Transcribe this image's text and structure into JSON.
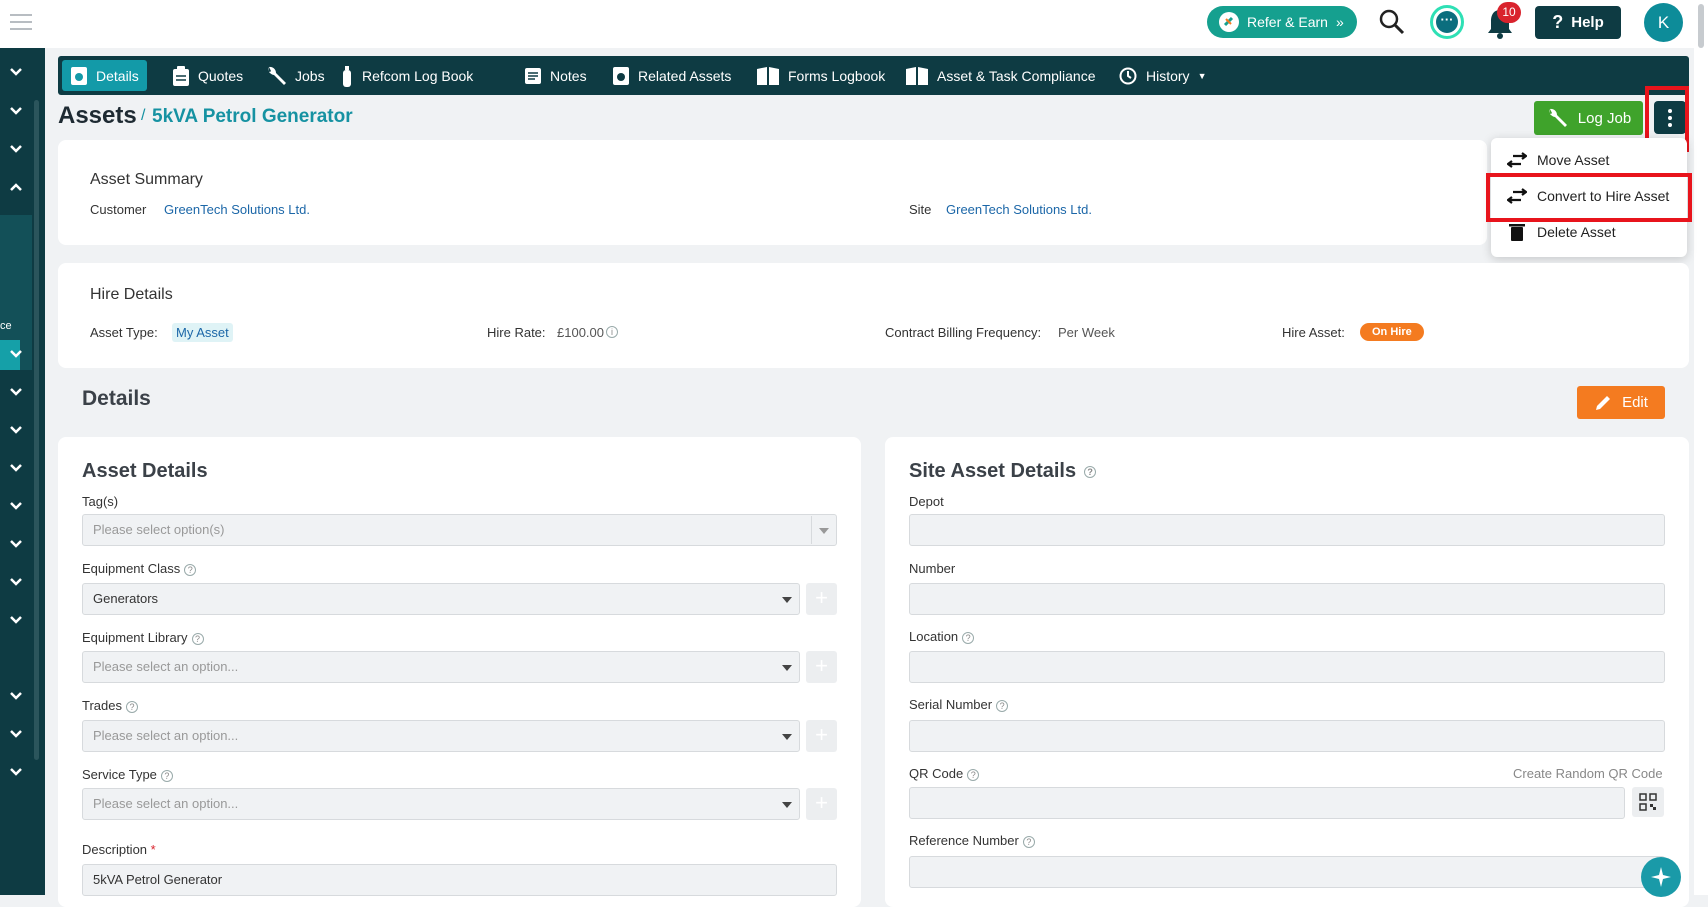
{
  "topbar": {
    "refer_label": "Refer & Earn",
    "notifications_count": "10",
    "help_label": "Help",
    "avatar_initial": "K"
  },
  "sidebar": {
    "partial_label": "ce"
  },
  "nav": {
    "tabs": [
      {
        "label": "Details",
        "icon": "asset-icon"
      },
      {
        "label": "Quotes",
        "icon": "clipboard-icon"
      },
      {
        "label": "Jobs",
        "icon": "wrench-icon"
      },
      {
        "label": "Refcom Log Book",
        "icon": "gas-bottle-icon"
      },
      {
        "label": "Notes",
        "icon": "note-icon"
      },
      {
        "label": "Related Assets",
        "icon": "asset-icon"
      },
      {
        "label": "Forms Logbook",
        "icon": "book-icon"
      },
      {
        "label": "Asset & Task Compliance",
        "icon": "book-icon"
      },
      {
        "label": "History",
        "icon": "history-icon"
      }
    ]
  },
  "header": {
    "title": "Assets",
    "separator": "/",
    "subtitle": "5kVA Petrol Generator",
    "log_job_label": "Log Job"
  },
  "menu": {
    "items": [
      {
        "label": "Move Asset",
        "icon": "swap-icon"
      },
      {
        "label": "Convert to Hire Asset",
        "icon": "swap-icon"
      },
      {
        "label": "Delete Asset",
        "icon": "trash-icon"
      }
    ]
  },
  "summary": {
    "title": "Asset Summary",
    "customer_label": "Customer",
    "customer_value": "GreenTech Solutions Ltd.",
    "site_label": "Site",
    "site_value": "GreenTech Solutions Ltd."
  },
  "hire": {
    "title": "Hire Details",
    "asset_type_label": "Asset Type:",
    "asset_type_value": "My Asset",
    "hire_rate_label": "Hire Rate:",
    "hire_rate_value": "£100.00",
    "billing_label": "Contract Billing Frequency:",
    "billing_value": "Per Week",
    "hire_asset_label": "Hire Asset:",
    "hire_asset_value": "On Hire"
  },
  "details": {
    "title": "Details",
    "edit_label": "Edit"
  },
  "asset_details": {
    "title": "Asset Details",
    "tags_label": "Tag(s)",
    "tags_placeholder": "Please select option(s)",
    "equipment_class_label": "Equipment Class",
    "equipment_class_value": "Generators",
    "equipment_library_label": "Equipment Library",
    "equipment_library_placeholder": "Please select an option...",
    "trades_label": "Trades",
    "trades_placeholder": "Please select an option...",
    "service_type_label": "Service Type",
    "service_type_placeholder": "Please select an option...",
    "description_label": "Description",
    "required_mark": "*",
    "description_value": "5kVA Petrol Generator"
  },
  "site_asset": {
    "title": "Site Asset Details",
    "depot_label": "Depot",
    "number_label": "Number",
    "location_label": "Location",
    "serial_label": "Serial Number",
    "qr_label": "QR Code",
    "create_qr_label": "Create Random QR Code",
    "reference_label": "Reference Number"
  },
  "colors": {
    "navy": "#0e3b43",
    "teal": "#139aa8",
    "green": "#3fa32b",
    "orange": "#f47b20",
    "highlight_red": "#e8141c"
  }
}
